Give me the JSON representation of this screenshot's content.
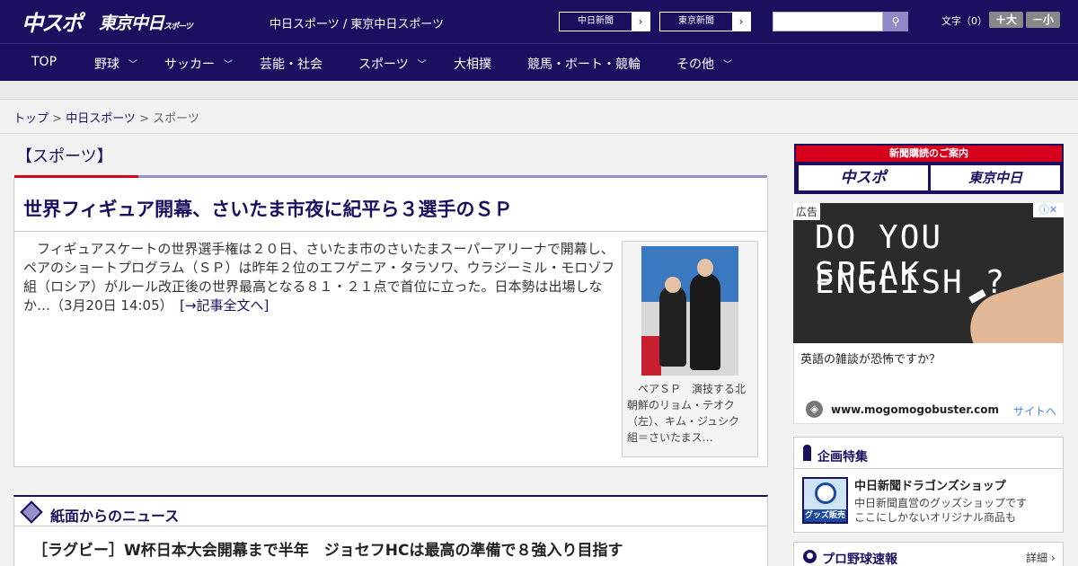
{
  "header": {
    "logo_chuspo": "中スポ",
    "logo_tokyo": "東京中日",
    "logo_tokyo_sub": "スポーツ",
    "site_title": "中日スポーツ / 東京中日スポーツ",
    "btn_chunichi": "中日新聞",
    "btn_tokyo": "東京新聞",
    "btn_arrow": "›",
    "search_placeholder": "",
    "search_icon": "search-icon",
    "font_size_label": "文字（0）",
    "font_up": "＋大",
    "font_down": "－小"
  },
  "nav": {
    "items": [
      {
        "label": "TOP"
      },
      {
        "label": "野球"
      },
      {
        "label": "サッカー"
      },
      {
        "label": "芸能・社会"
      },
      {
        "label": "スポーツ"
      },
      {
        "label": "大相撲"
      },
      {
        "label": "競馬・ボート・競輪"
      },
      {
        "label": "その他"
      }
    ],
    "chevron": "﹀"
  },
  "breadcrumb": {
    "top": "トップ",
    "sep": " > ",
    "chunichi": "中日スポーツ",
    "current": "スポーツ"
  },
  "section": {
    "heading": "【スポーツ】"
  },
  "article": {
    "title": "世界フィギュア開幕、さいたま市夜に紀平ら３選手のＳＰ",
    "body": "　フィギュアスケートの世界選手権は２０日、さいたま市のさいたまスーパーアリーナで開幕し、ペアのショートプログラム（ＳＰ）は昨年２位のエフゲニア・タラソワ、ウラジーミル・モロゾフ組（ロシア）がルール改正後の世界最高となる８１・２１点で首位に立った。日本勢は出場しなか…（3月20日 14:05）　",
    "more_link": "[→記事全文へ]",
    "photo_caption": "　ペアＳＰ　演技する北朝鮮のリョム・テオク（左）、キム・ジュシク組＝さいたまス…"
  },
  "news": {
    "heading": "紙面からのニュース",
    "item1": "［ラグビー］W杯日本大会開幕まで半年　ジョセフHCは最高の準備で８強入り目指す"
  },
  "sidebar": {
    "subscribe_title": "新聞購読のご案内",
    "subscribe_chuspo": "中スポ",
    "subscribe_tokyo": "東京中日",
    "ad_label": "広告",
    "ad_close": "ⓘ✕",
    "ad_image_line1": "DO YOU SPEAK",
    "ad_image_line2": "ENGLISH ?",
    "ad_question": "英語の雑談が恐怖ですか？",
    "ad_url": "www.mogomogobuster.com",
    "ad_site_link": "サイトへ",
    "feature_heading": "企画特集",
    "feature_title": "中日新聞ドラゴンズショップ",
    "feature_desc1": "中日新聞直営のグッズショップです",
    "feature_desc2": "ここにしかないオリジナル商品も",
    "feature_badge": "グッズ販売中",
    "baseball_heading": "プロ野球速報",
    "baseball_detail": "詳細 ›"
  },
  "colors": {
    "navy": "#1a1060",
    "accent_red": "#d6001c",
    "accent_lavender": "#9690c8"
  }
}
